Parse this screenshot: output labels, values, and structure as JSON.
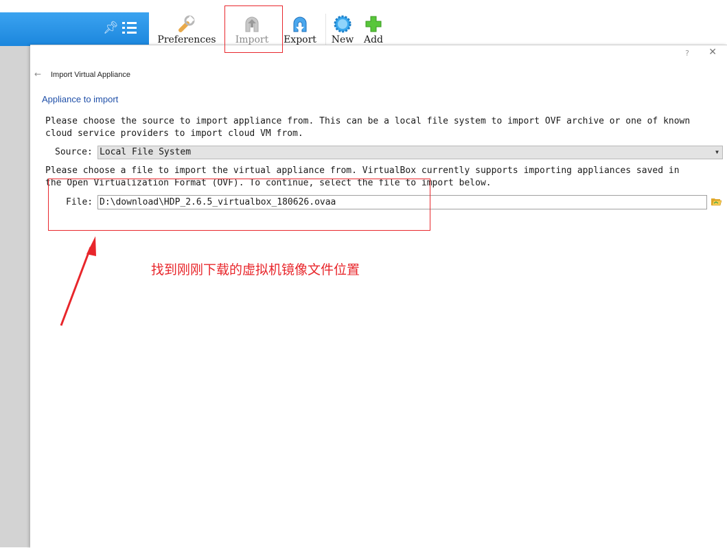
{
  "toolbar": {
    "buttons": [
      {
        "label": "Preferences",
        "icon": "wrench-icon"
      },
      {
        "label": "Import",
        "icon": "import-icon"
      },
      {
        "label": "Export",
        "icon": "export-icon"
      },
      {
        "label": "New",
        "icon": "new-gear-icon"
      },
      {
        "label": "Add",
        "icon": "add-plus-icon"
      }
    ]
  },
  "dialog": {
    "help": "?",
    "close": "✕",
    "title": "Import Virtual Appliance",
    "heading": "Appliance to import",
    "source_intro": "Please choose the source to import appliance from. This can be a local file system to import OVF archive or one of known\ncloud service providers to import cloud VM from.",
    "source_label": "Source:",
    "source_value": "Local File System",
    "file_intro": "Please choose a file to import the virtual appliance from. VirtualBox currently supports importing appliances saved in\nthe Open Virtualization Format (OVF). To continue, select the file to import below.",
    "file_label": "File:",
    "file_value": "D:\\download\\HDP_2.6.5_virtualbox_180626.ovaa"
  },
  "annotation": {
    "text": "找到刚刚下载的虚拟机镜像文件位置",
    "color": "#e8262b"
  },
  "colors": {
    "accent_blue": "#1b86dd",
    "heading_blue": "#1f4fa8"
  }
}
